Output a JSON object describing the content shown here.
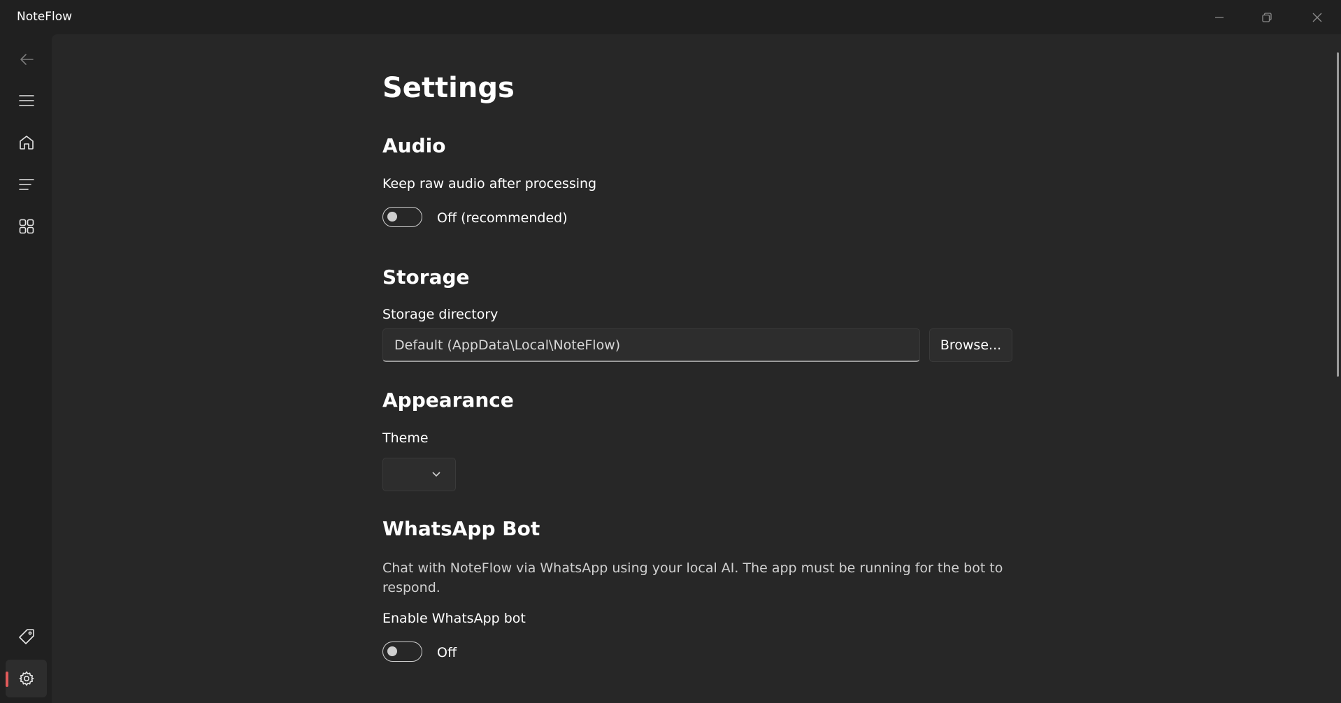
{
  "app": {
    "title": "NoteFlow"
  },
  "window_controls": [
    "minimize-icon",
    "restore-icon",
    "close-icon"
  ],
  "nav": {
    "items": [
      {
        "name": "back",
        "icon": "back-arrow-icon"
      },
      {
        "name": "menu",
        "icon": "hamburger-menu-icon"
      },
      {
        "name": "home",
        "icon": "home-icon"
      },
      {
        "name": "notes-list",
        "icon": "list-icon"
      },
      {
        "name": "apps",
        "icon": "grid-icon"
      },
      {
        "name": "tags",
        "icon": "tag-icon"
      },
      {
        "name": "settings",
        "icon": "gear-icon",
        "selected": true
      }
    ],
    "indicator_color": "#e05a5a"
  },
  "settings": {
    "title": "Settings",
    "audio": {
      "title": "Audio",
      "keep_raw_label": "Keep raw audio after processing",
      "toggle_state": "Off (recommended)",
      "enabled": false
    },
    "storage": {
      "title": "Storage",
      "directory_label": "Storage directory",
      "directory_value": "Default (AppData\\Local\\NoteFlow)",
      "browse_label": "Browse..."
    },
    "appearance": {
      "title": "Appearance",
      "theme_label": "Theme",
      "theme_value": ""
    },
    "whatsapp": {
      "title": "WhatsApp Bot",
      "description": "Chat with NoteFlow via WhatsApp using your local AI. The app must be running for the bot to respond.",
      "enable_label": "Enable WhatsApp bot",
      "toggle_state": "Off",
      "enabled": false
    }
  },
  "colors": {
    "background": "#202020",
    "content_background": "#272727",
    "control_background": "#2d2d2d",
    "text": "#ffffff",
    "secondary_text": "#d0d0d0"
  }
}
